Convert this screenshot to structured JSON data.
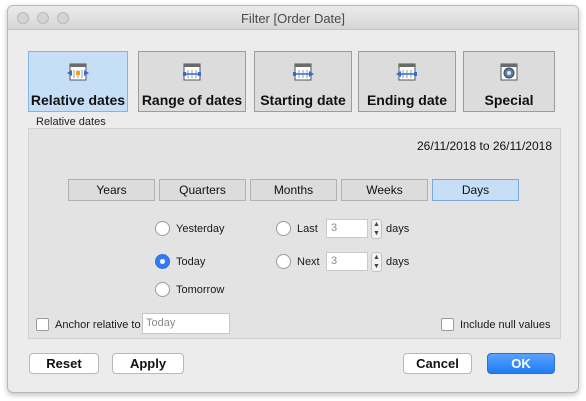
{
  "window": {
    "title": "Filter [Order Date]"
  },
  "modes": [
    {
      "label": "Relative dates",
      "icon": "relative-dates-icon",
      "active": true
    },
    {
      "label": "Range of dates",
      "icon": "range-of-dates-icon",
      "active": false
    },
    {
      "label": "Starting date",
      "icon": "starting-date-icon",
      "active": false
    },
    {
      "label": "Ending date",
      "icon": "ending-date-icon",
      "active": false
    },
    {
      "label": "Special",
      "icon": "special-icon",
      "active": false
    }
  ],
  "relative": {
    "section_label": "Relative dates",
    "date_range": "26/11/2018 to 26/11/2018",
    "units": [
      "Years",
      "Quarters",
      "Months",
      "Weeks",
      "Days"
    ],
    "selected_unit": "Days",
    "options": {
      "yesterday": "Yesterday",
      "today": "Today",
      "tomorrow": "Tomorrow",
      "last": "Last",
      "next": "Next"
    },
    "selected_option": "Today",
    "last_value": "3",
    "next_value": "3",
    "days_label": "days",
    "anchor_label": "Anchor relative to",
    "anchor_placeholder": "Today",
    "include_null_label": "Include null values"
  },
  "footer": {
    "reset": "Reset",
    "apply": "Apply",
    "cancel": "Cancel",
    "ok": "OK"
  },
  "colors": {
    "accent": "#1f7cf4",
    "active_tab": "#c7def7"
  }
}
